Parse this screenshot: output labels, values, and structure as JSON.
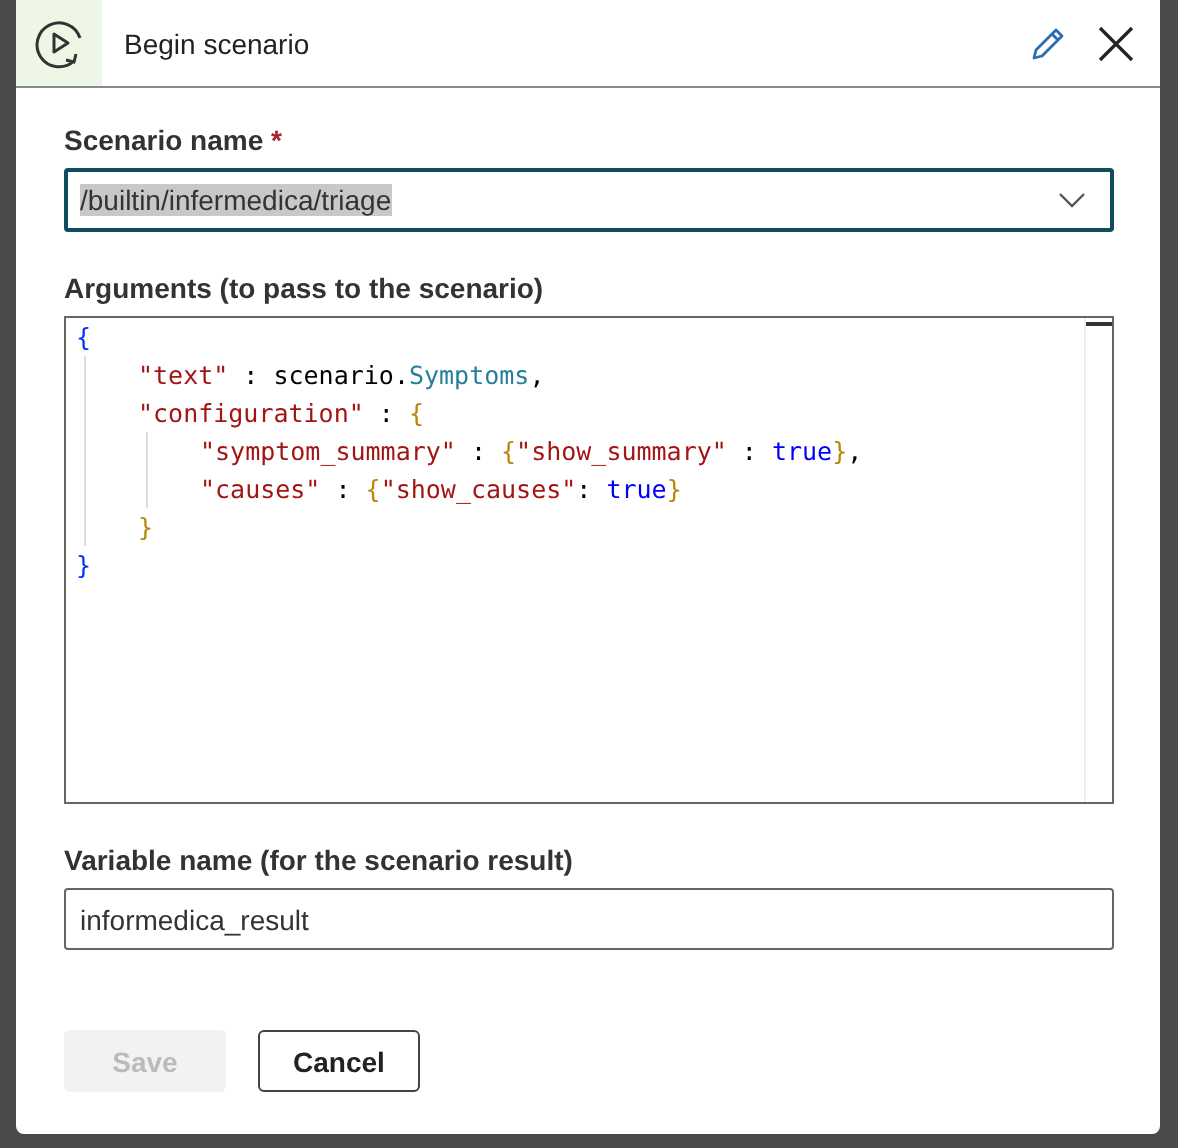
{
  "dialog": {
    "title": "Begin scenario"
  },
  "scenario_name": {
    "label": "Scenario name",
    "required_mark": "*",
    "value": "/builtin/infermedica/triage",
    "text_selected": true
  },
  "arguments": {
    "label": "Arguments (to pass to the scenario)",
    "code": [
      {
        "tokens": [
          {
            "kind": "brace1",
            "text": "{"
          }
        ],
        "children": [
          {
            "tokens": [
              {
                "kind": "string",
                "text": "\"text\""
              },
              {
                "kind": "plain",
                "text": " : scenario."
              },
              {
                "kind": "member",
                "text": "Symptoms"
              },
              {
                "kind": "plain",
                "text": ","
              }
            ]
          },
          {
            "tokens": [
              {
                "kind": "string",
                "text": "\"configuration\""
              },
              {
                "kind": "plain",
                "text": " : "
              },
              {
                "kind": "brace2",
                "text": "{"
              }
            ],
            "children": [
              {
                "tokens": [
                  {
                    "kind": "string",
                    "text": "\"symptom_summary\""
                  },
                  {
                    "kind": "plain",
                    "text": " : "
                  },
                  {
                    "kind": "brace2",
                    "text": "{"
                  },
                  {
                    "kind": "string",
                    "text": "\"show_summary\""
                  },
                  {
                    "kind": "plain",
                    "text": " : "
                  },
                  {
                    "kind": "keyword",
                    "text": "true"
                  },
                  {
                    "kind": "brace2",
                    "text": "}"
                  },
                  {
                    "kind": "plain",
                    "text": ","
                  }
                ]
              },
              {
                "tokens": [
                  {
                    "kind": "string",
                    "text": "\"causes\""
                  },
                  {
                    "kind": "plain",
                    "text": " : "
                  },
                  {
                    "kind": "brace2",
                    "text": "{"
                  },
                  {
                    "kind": "string",
                    "text": "\"show_causes\""
                  },
                  {
                    "kind": "plain",
                    "text": ": "
                  },
                  {
                    "kind": "keyword",
                    "text": "true"
                  },
                  {
                    "kind": "brace2",
                    "text": "}"
                  }
                ]
              }
            ]
          },
          {
            "tokens": [
              {
                "kind": "brace2",
                "text": "}"
              }
            ]
          }
        ]
      },
      {
        "tokens": [
          {
            "kind": "brace1",
            "text": "}"
          }
        ]
      }
    ]
  },
  "variable_name": {
    "label": "Variable name (for the scenario result)",
    "value": "informedica_result"
  },
  "buttons": [
    {
      "label": "Save",
      "disabled": true
    },
    {
      "label": "Cancel",
      "disabled": false
    }
  ]
}
